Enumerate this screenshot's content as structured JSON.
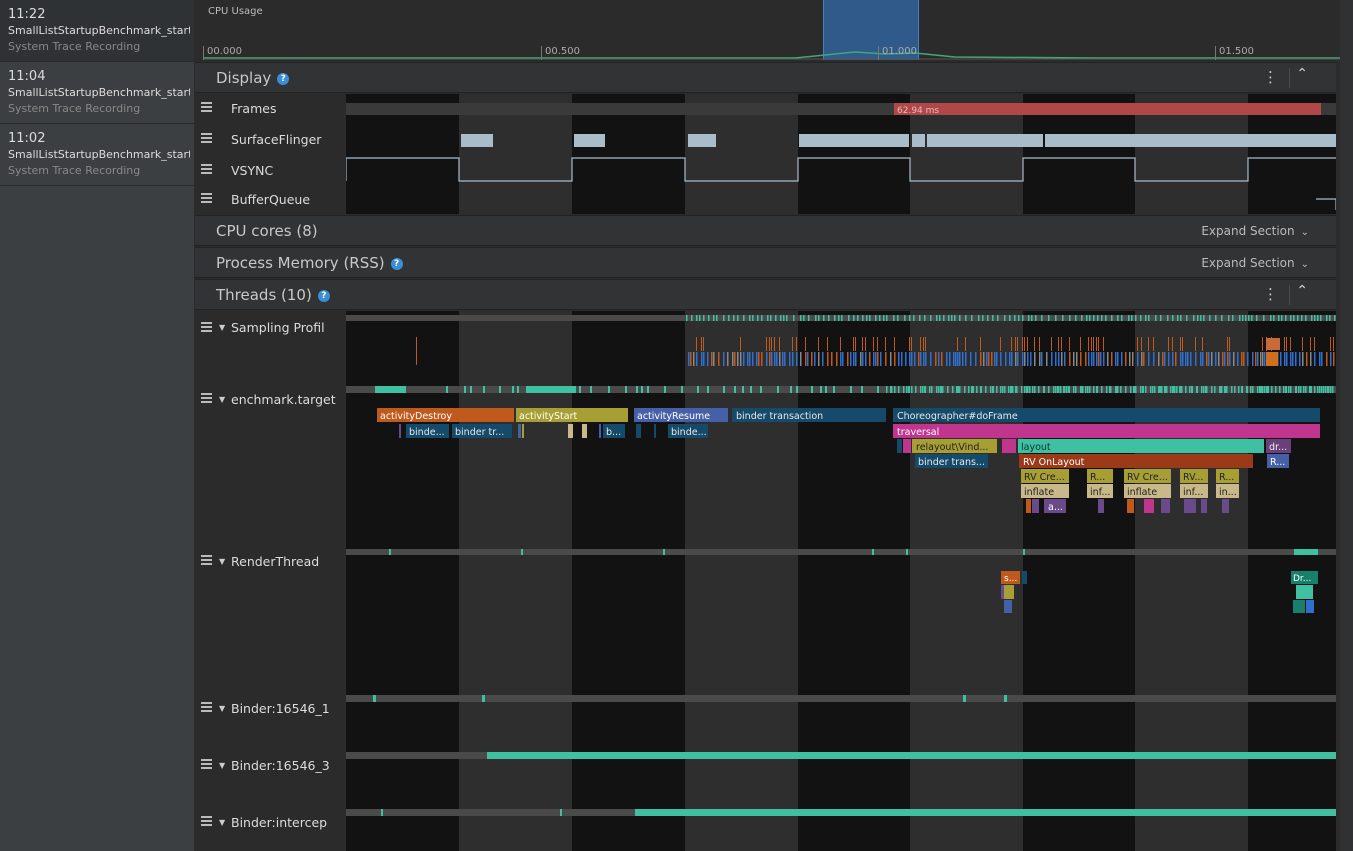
{
  "recordings": [
    {
      "time": "11:22",
      "name": "SmallListStartupBenchmark_start...",
      "type": "System Trace Recording"
    },
    {
      "time": "11:04",
      "name": "SmallListStartupBenchmark_start...",
      "type": "System Trace Recording"
    },
    {
      "time": "11:02",
      "name": "SmallListStartupBenchmark_start...",
      "type": "System Trace Recording"
    }
  ],
  "cpu_usage": {
    "label": "CPU Usage",
    "ticks": [
      "00.000",
      "00.500",
      "01.000",
      "01.500"
    ]
  },
  "sections": {
    "display": {
      "title": "Display",
      "help": "?"
    },
    "cpu_cores": {
      "title": "CPU cores (8)",
      "action": "Expand Section"
    },
    "process_memory": {
      "title": "Process Memory (RSS)",
      "help": "?",
      "action": "Expand Section"
    },
    "threads": {
      "title": "Threads (10)",
      "help": "?"
    }
  },
  "display_tracks": [
    "Frames",
    "SurfaceFlinger",
    "VSYNC",
    "BufferQueue"
  ],
  "frame_label": "62.94 ms",
  "thread_tracks": [
    "Sampling Profil",
    "enchmark.target",
    "RenderThread",
    "Binder:16546_1",
    "Binder:16546_3",
    "Binder:intercep"
  ],
  "slices": {
    "activityDestroy": "activityDestroy",
    "activityStart": "activityStart",
    "activityResume": "activityResume",
    "binder_transaction": "binder transaction",
    "choreographer": "Choreographer#doFrame",
    "traversal": "traversal",
    "relayout": "relayout\\Vind...",
    "layout": "layout",
    "dr": "dr...",
    "binder_trans": "binder trans...",
    "rv_onlayout": "RV OnLayout",
    "r": "R...",
    "rv_cre": "RV Cre...",
    "inflate": "inflate",
    "inf": "inf...",
    "rv": "RV...",
    "in": "in...",
    "a": "a...",
    "binder_dots": "binde...",
    "binder_tr": "binder tr...",
    "b": "b...",
    "s": "s...",
    "dr2": "Dr..."
  },
  "colors": {
    "sidebar": "#3c3f41",
    "panel": "#2b2b2b",
    "frame_slow": "#b0484a",
    "surface": "#a9bcca",
    "teal": "#3fc0a0",
    "orange": "#c05a1c",
    "olive": "#a79f34",
    "indigo": "#4660a8",
    "navy": "#164a6a",
    "magenta": "#c0368e",
    "brown": "#9a3a18",
    "help": "#3b8ed6"
  }
}
